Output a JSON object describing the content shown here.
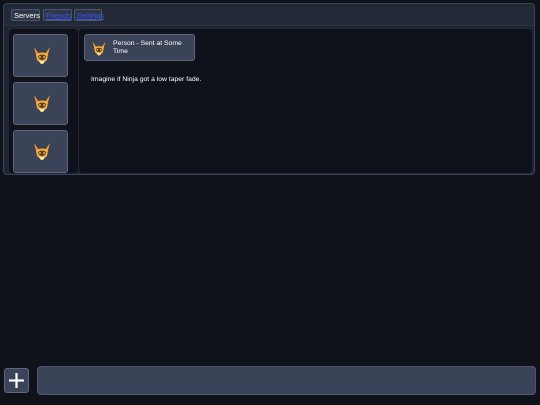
{
  "tabs": [
    {
      "label": "Servers",
      "active": true
    },
    {
      "label": "Friends",
      "active": false
    },
    {
      "label": "Settings",
      "active": false
    }
  ],
  "servers": [
    {
      "icon": "fox-avatar-icon"
    },
    {
      "icon": "fox-avatar-icon"
    },
    {
      "icon": "fox-avatar-icon"
    }
  ],
  "message": {
    "author_line": "Person - Sent at Some Time",
    "avatar_icon": "fox-avatar-icon",
    "text": "Imagine if Ninja got a low taper fade."
  },
  "composer": {
    "add_icon": "plus-icon",
    "input_value": "",
    "input_placeholder": ""
  },
  "colors": {
    "background": "#101219",
    "panel": "#0f121a",
    "frame": "#1f2532",
    "tile": "#3a4357",
    "link": "#3a56e8",
    "avatar_orange": "#f2a21c"
  }
}
